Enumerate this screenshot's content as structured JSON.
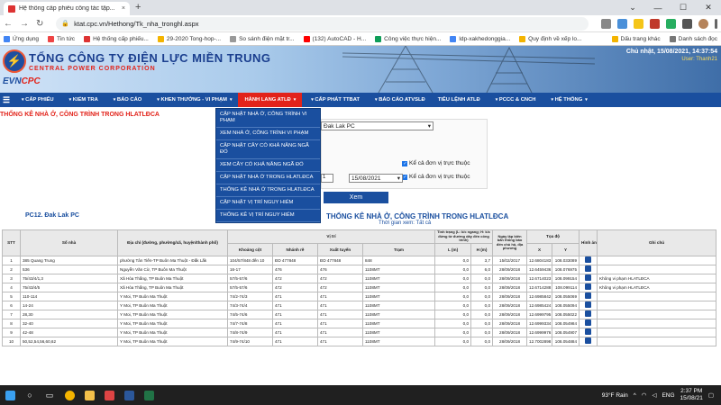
{
  "browser": {
    "tab_title": "Hệ thống cấp phiếu công tác tập...",
    "tab_close": "×",
    "new_tab": "+",
    "url": "ktat.cpc.vn/Hethong/Tk_nha_tronghl.aspx",
    "minimize": "—",
    "maximize": "☐",
    "close": "✕",
    "dots": "⌄"
  },
  "bookmarks": {
    "items": [
      "Ứng dụng",
      "Tin tức",
      "Hệ thống cấp phiếu...",
      "29-2020 Tong-hop-...",
      "So sánh điện mặt tr...",
      "(132) AutoCAD - H...",
      "Công việc thực hiện...",
      "ldp-xakhedonggia...",
      "Quy định về xếp lo..."
    ],
    "right": [
      "Dấu trang khác",
      "Danh sách đọc"
    ]
  },
  "banner": {
    "title": "TỔNG CÔNG TY ĐIỆN LỰC MIỀN TRUNG",
    "subtitle": "CENTRAL POWER CORPORATION",
    "brand_evn": "EVN",
    "brand_cpc": "CPC",
    "date": "Chủ nhật, 15/08/2021, 14:37:54",
    "user": "User: Thanh21"
  },
  "menu": {
    "items": [
      "CẤP PHIẾU",
      "KIỂM TRA",
      "BÁO CÁO",
      "KHEN THƯỞNG - VI PHẠM",
      "HÀNH LANG ATLĐ",
      "CẤP PHÁT TTBAT",
      "BÁO CÁO ATVSLĐ",
      "TIÊU LỆNH ATLĐ",
      "PCCC & CNCH",
      "HỆ THỐNG"
    ],
    "active_index": 4
  },
  "dropdown": [
    "CẬP NHẬT NHÀ Ở, CÔNG TRÌNH VI PHẠM",
    "XEM NHÀ Ở, CÔNG TRÌNH VI PHẠM",
    "CẬP NHẬT CÂY CÓ KHẢ NĂNG NGÃ ĐỔ",
    "XEM CÂY CÓ KHẢ NĂNG NGÃ ĐỔ",
    "CẬP NHẬT NHÀ Ở TRONG HLATLĐCA",
    "THỐNG KÊ NHÀ Ở TRONG HLATLĐCA",
    "CẬP NHẬT VỊ TRÍ NGUY HIỂM",
    "THỐNG KÊ VỊ TRÍ NGUY HIỂM"
  ],
  "page": {
    "title": "THỐNG KÊ NHÀ Ở, CÔNG TRÌNH TRONG HLATLĐCA",
    "unit_select": "Đak Lak PC",
    "chk1": "Kể cả đơn vị trực thuộc",
    "chk2": "Kể cả đơn vị trực thuộc",
    "date_to": "15/08/2021",
    "button": "Xem",
    "pc_label": "PC12. Đak Lak PC",
    "report_title": "THỐNG KÊ NHÀ Ở, CÔNG TRÌNH TRONG HLATLĐCA",
    "report_sub": "Thời gian xem: Tất cả"
  },
  "table": {
    "headers": {
      "stt": "STT",
      "so_nha": "Số nhà",
      "dia_chi": "Địa chỉ (đường, phường/xã, huyện/thành phố)",
      "vi_tri": "Vị trí",
      "khoang_cot": "Khoảng cột",
      "nhanh_re": "Nhánh rẽ",
      "xuat_tuyen": "Xuất tuyến",
      "tram": "Trạm",
      "tinh_trang": "Tình trạng (L: k/c ngang; H: k/c đứng từ đường dây đến công trình)",
      "L": "L (m)",
      "H": "H (m)",
      "ngay_lap": "Ngày lập biên bản thông báo đến chủ hộ, địa phương",
      "toa_do": "Tọa độ",
      "X": "X",
      "Y": "Y",
      "hinh_anh": "Hình ảnh",
      "ghi_chu": "Ghi chú"
    },
    "rows": [
      [
        "1",
        "385 Quang Trung",
        "phường Tân Tiến-TP Buôn Ma Thuột - Đắk Lắk",
        "104/57/848 đến 10",
        "ĐD 477848",
        "ĐD 477848",
        "848",
        "0,0",
        "3,7",
        "15/02/2017",
        "12.6804183",
        "108.033089",
        ""
      ],
      [
        "2",
        "536",
        "Nguyễn Văn Cừ, TP Buôn Ma Thuột",
        "16-17",
        "476",
        "476",
        "1108MT",
        "0,0",
        "6,0",
        "28/09/2018",
        "12.6459436",
        "108.076975",
        ""
      ],
      [
        "3",
        "75/43/4/1,3",
        "Xã Hòa Thắng, TP Buôn Ma Thuột",
        "57/5-57/6",
        "472",
        "472",
        "1108MT",
        "0,0",
        "0,0",
        "28/09/2018",
        "12.6714023",
        "108.099154",
        "Không vi phạm HLATLĐCA"
      ],
      [
        "4",
        "75/43/4/5",
        "Xã Hòa Thắng, TP Buôn Ma Thuột",
        "57/5-57/6",
        "472",
        "472",
        "1108MT",
        "0,0",
        "0,0",
        "28/09/2018",
        "12.6714288",
        "108.099114",
        "Không vi phạm HLATLĐCA"
      ],
      [
        "5",
        "110-114",
        "Y Moi, TP Buôn Ma Thuột",
        "74/2-74/3",
        "471",
        "471",
        "1108MT",
        "0,0",
        "0,0",
        "28/09/2018",
        "12.6985842",
        "108.055069",
        ""
      ],
      [
        "6",
        "14-24",
        "Y Moi, TP Buôn Ma Thuột",
        "74/3-74/4",
        "471",
        "471",
        "1108MT",
        "0,0",
        "0,0",
        "28/09/2018",
        "12.6985424",
        "108.055094",
        ""
      ],
      [
        "7",
        "28,30",
        "Y Moi, TP Buôn Ma Thuột",
        "74/5-74/6",
        "471",
        "471",
        "1108MT",
        "0,0",
        "0,0",
        "28/09/2018",
        "12.6999795",
        "108.055022",
        ""
      ],
      [
        "8",
        "32-40",
        "Y Moi, TP Buôn Ma Thuột",
        "74/7-74/8",
        "471",
        "471",
        "1108MT",
        "0,0",
        "0,0",
        "28/09/2018",
        "12.6999334",
        "108.054984",
        ""
      ],
      [
        "9",
        "42-48",
        "Y Moi, TP Buôn Ma Thuột",
        "74/8-74/9",
        "471",
        "471",
        "1108MT",
        "0,0",
        "0,0",
        "28/09/2018",
        "12.6999976",
        "108.054907",
        ""
      ],
      [
        "10",
        "50,52,54,56,60,62",
        "Y Moi, TP Buôn Ma Thuột",
        "74/9-74/10",
        "471",
        "471",
        "1108MT",
        "0,0",
        "0,0",
        "28/09/2018",
        "12.7002898",
        "108.054884",
        ""
      ]
    ]
  },
  "taskbar": {
    "weather": "93°F  Rain",
    "lang": "ENG",
    "time": "2:37 PM",
    "date": "15/08/21"
  }
}
